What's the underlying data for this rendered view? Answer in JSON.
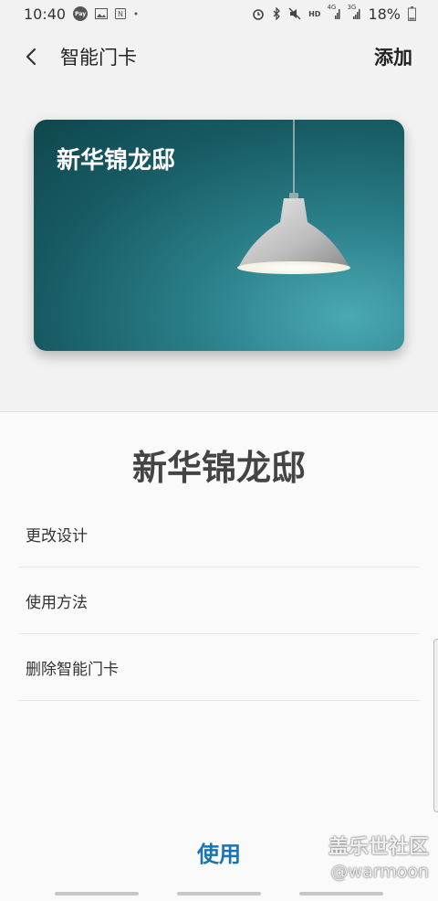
{
  "status_bar": {
    "time": "10:40",
    "battery_percent": "18%",
    "icons_left": [
      "pay-icon",
      "gallery-icon",
      "nfc-icon",
      "dot-icon"
    ],
    "icons_right": [
      "alarm-icon",
      "bluetooth-icon",
      "mute-icon",
      "hd-icon",
      "signal-4g-icon",
      "signal-3g-icon",
      "battery-icon"
    ],
    "hd_label": "HD",
    "net_4g": "4G",
    "net_3g": "3G"
  },
  "app_bar": {
    "title": "智能门卡",
    "add_label": "添加"
  },
  "card": {
    "name": "新华锦龙邸"
  },
  "sheet": {
    "title": "新华锦龙邸",
    "menu": [
      {
        "label": "更改设计"
      },
      {
        "label": "使用方法"
      },
      {
        "label": "删除智能门卡"
      }
    ],
    "use_label": "使用"
  },
  "watermark": {
    "brand": "盖乐世社区",
    "user": "@warmoon"
  },
  "colors": {
    "accent": "#1a73b5",
    "card_teal": "#175a62"
  }
}
